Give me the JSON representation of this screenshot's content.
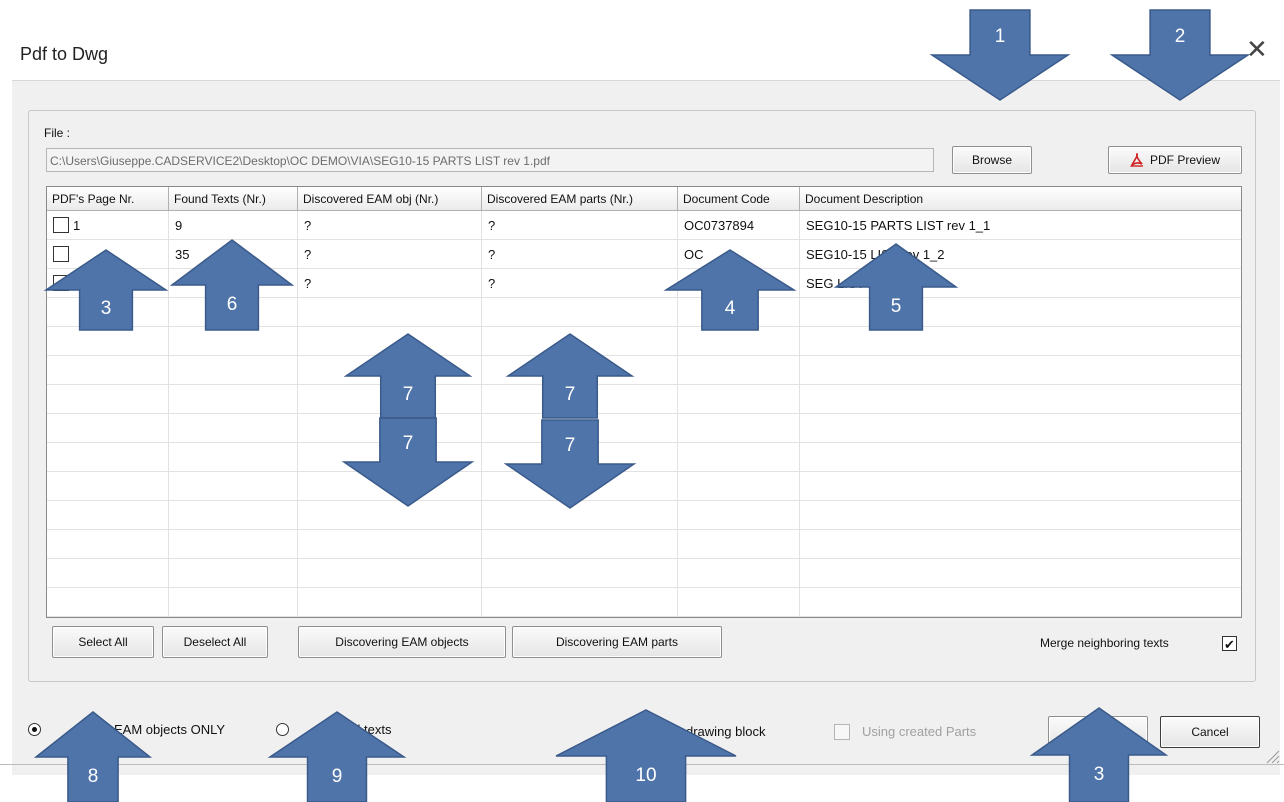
{
  "window": {
    "title": "Pdf to Dwg",
    "close_glyph": "✕"
  },
  "file": {
    "label": "File :",
    "path": "C:\\Users\\Giuseppe.CADSERVICE2\\Desktop\\OC DEMO\\VIA\\SEG10-15 PARTS LIST rev 1.pdf"
  },
  "buttons": {
    "browse": "Browse",
    "pdf_preview": "PDF Preview",
    "select_all": "Select All",
    "deselect_all": "Deselect All",
    "discover_objects": "Discovering EAM objects",
    "discover_parts": "Discovering EAM parts",
    "cancel": "Cancel"
  },
  "grid": {
    "columns": [
      "PDF's Page Nr.",
      "Found Texts (Nr.)",
      "Discovered EAM obj (Nr.)",
      "Discovered EAM parts (Nr.)",
      "Document Code",
      "Document Description"
    ],
    "rows": [
      {
        "page": "1",
        "found": "9",
        "obj": "?",
        "parts": "?",
        "code": "OC0737894",
        "desc": "SEG10-15 PARTS LIST rev 1_1"
      },
      {
        "page": "",
        "found": "35",
        "obj": "?",
        "parts": "?",
        "code": "OC",
        "desc": "SEG10-15 LIST rev 1_2"
      },
      {
        "page": "",
        "found": "",
        "obj": "?",
        "parts": "?",
        "code": "",
        "desc": "SEG LIST rev 1_3"
      }
    ]
  },
  "merge": {
    "label": "Merge neighboring texts",
    "checked": true
  },
  "options": {
    "radio_objects": "EAM objects ONLY",
    "radio_texts": "All texts",
    "drawing_block": "drawing block",
    "using_parts": "Using created Parts"
  },
  "callouts": [
    {
      "num": "1",
      "dir": "down"
    },
    {
      "num": "2",
      "dir": "down"
    },
    {
      "num": "3",
      "dir": "up"
    },
    {
      "num": "6",
      "dir": "up"
    },
    {
      "num": "4",
      "dir": "up"
    },
    {
      "num": "5",
      "dir": "up"
    },
    {
      "num": "7",
      "dir": "up"
    },
    {
      "num": "7",
      "dir": "up"
    },
    {
      "num": "7",
      "dir": "down"
    },
    {
      "num": "7",
      "dir": "down"
    },
    {
      "num": "8",
      "dir": "up"
    },
    {
      "num": "9",
      "dir": "up"
    },
    {
      "num": "10",
      "dir": "up"
    },
    {
      "num": "3",
      "dir": "up"
    }
  ],
  "colors": {
    "arrow_fill": "#4f74aa",
    "arrow_stroke": "#3a5a8a"
  },
  "icons": [
    "pdf-icon",
    "close-icon",
    "resize-grip-icon"
  ]
}
